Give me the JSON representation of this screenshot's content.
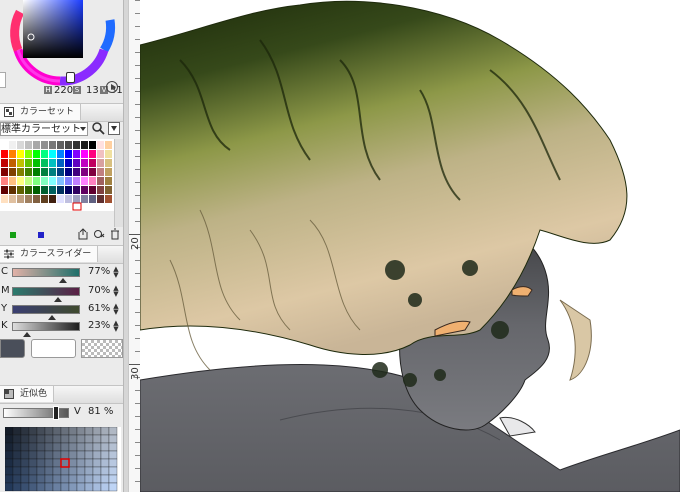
{
  "color_circle": {
    "h_value": "220",
    "s_value": "13",
    "v_value": "31",
    "h_label": "H",
    "s_label": "S",
    "v_label": "V"
  },
  "color_set_panel": {
    "tab_label": "カラーセット",
    "dropdown_value": "標準カラーセット"
  },
  "color_slider_panel": {
    "tab_label": "カラースライダー",
    "sliders": [
      {
        "letter": "C",
        "value": "77%",
        "fraction": 0.77,
        "color_start": "#e1b1a7",
        "color_end": "#1f6f6a"
      },
      {
        "letter": "M",
        "value": "70%",
        "fraction": 0.7,
        "color_start": "#2b7b6d",
        "color_end": "#5a1f45"
      },
      {
        "letter": "Y",
        "value": "61%",
        "fraction": 0.61,
        "color_start": "#3b3f72",
        "color_end": "#3f4a2e"
      },
      {
        "letter": "K",
        "value": "23%",
        "fraction": 0.23,
        "color_start": "#dddddd",
        "color_end": "#1e1e1e"
      }
    ],
    "main_color": "#4a4f5a",
    "sub_color": "#ffffff"
  },
  "approx_color_panel": {
    "tab_label": "近似色",
    "v_label": "V",
    "v_value": "81 %",
    "v_fraction": 0.81
  },
  "ruler": {
    "labels": [
      "20",
      "30"
    ]
  },
  "colors": {
    "panel_bg": "#ebebeb",
    "ruler_bg": "#f7f7f7",
    "hair_dark": "#2c3a14",
    "hair_mid": "#7b8a35",
    "hair_light": "#d9c09a",
    "skin": "#6e7078",
    "eye": "#f0b070"
  }
}
